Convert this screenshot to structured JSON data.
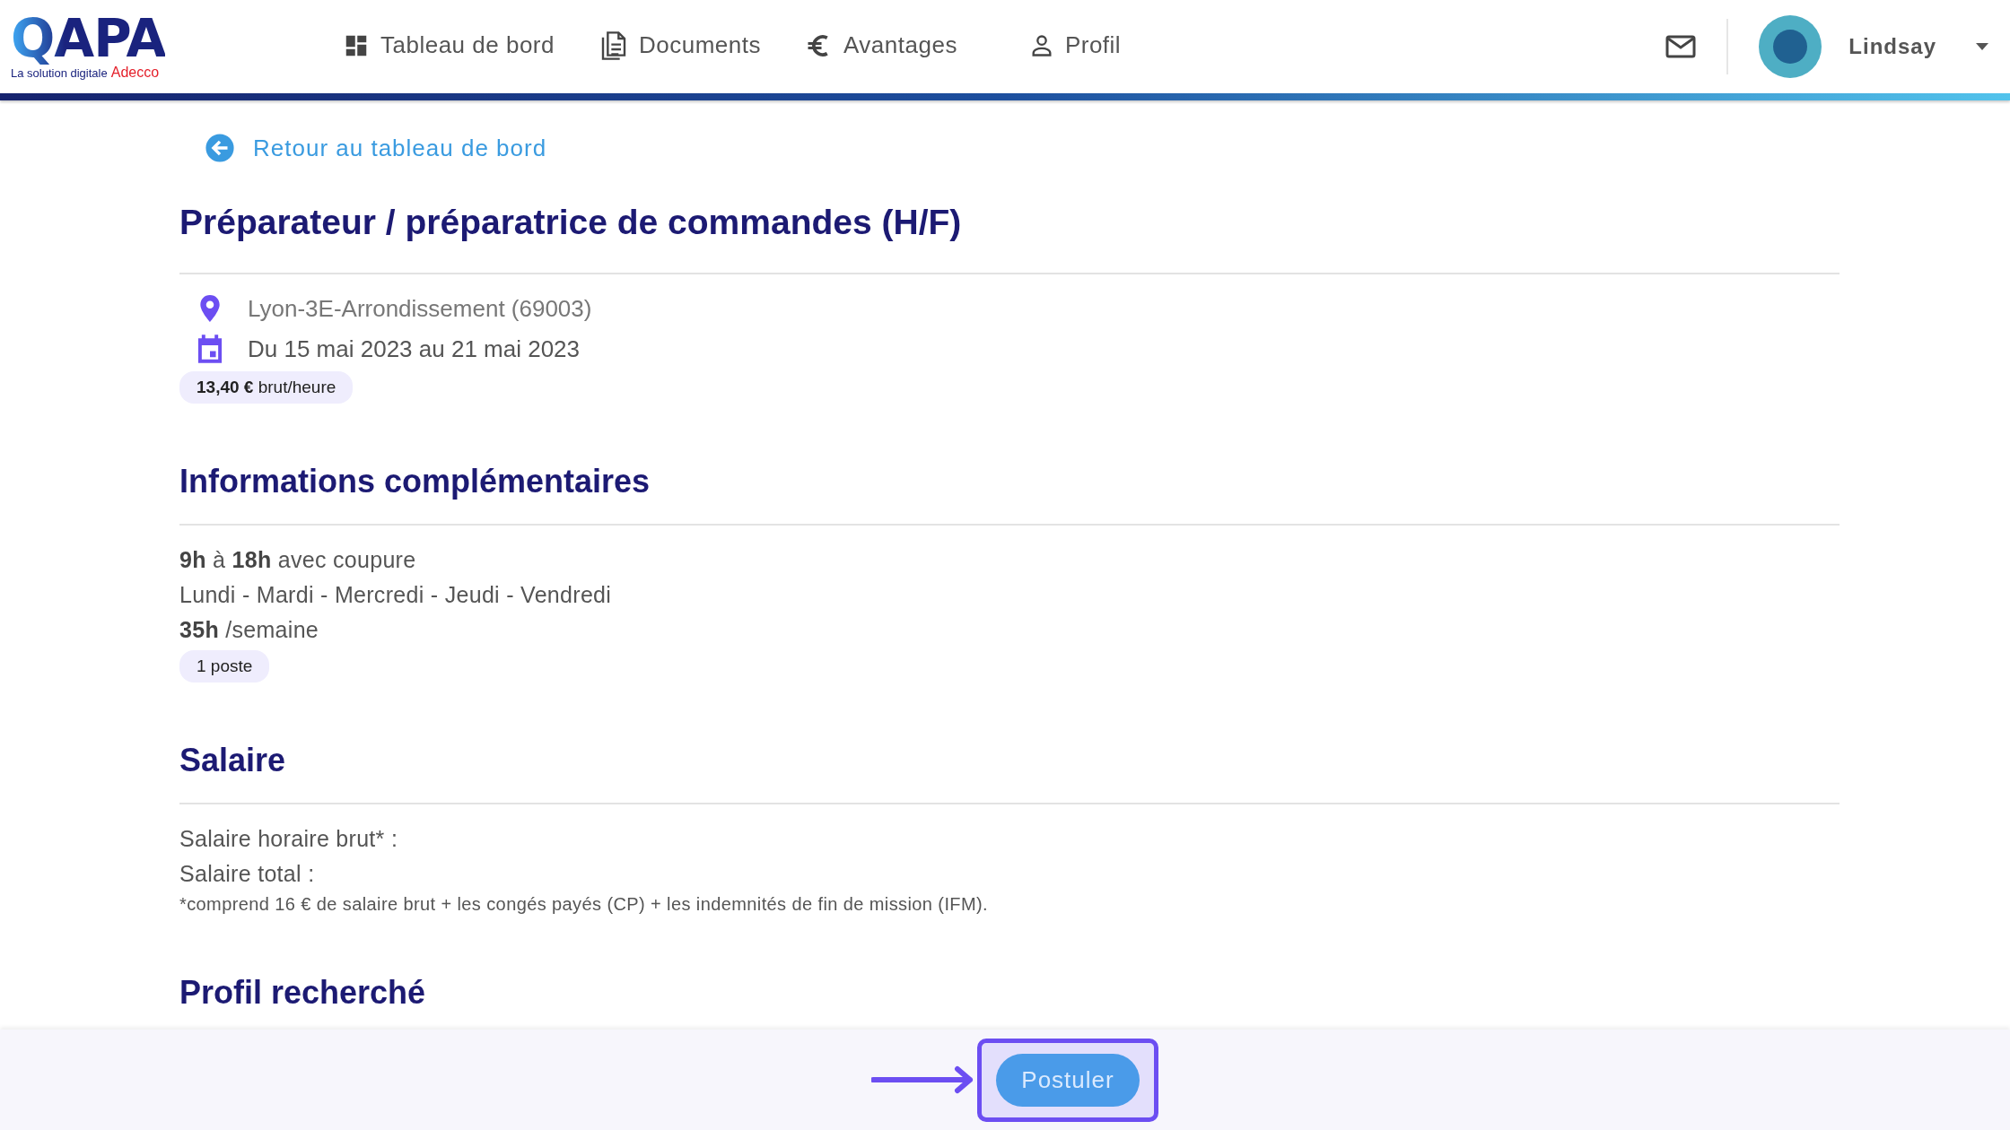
{
  "header": {
    "logo": {
      "wordmark": "QAPA",
      "tagline": "La solution digitale",
      "brand": "Adecco"
    },
    "nav": [
      {
        "label": "Tableau de bord",
        "kind": "dashboard",
        "selected": false
      },
      {
        "label": "Documents",
        "kind": "document",
        "selected": false
      },
      {
        "label": "Avantages",
        "kind": "euro",
        "selected": false
      },
      {
        "label": "Profil",
        "kind": "person",
        "selected": false
      }
    ],
    "user": {
      "name": "Lindsay"
    }
  },
  "back_link": "Retour au tableau de bord",
  "job": {
    "title": "Préparateur / préparatrice de commandes (H/F)",
    "details": [
      {
        "kind": "location",
        "text": "Lyon-3E-Arrondissement (69003)"
      },
      {
        "kind": "date",
        "text": "Du 15 mai 2023 au 21 mai 2023"
      }
    ],
    "rate": "**13,40 €** brut/heure"
  },
  "sections": [
    {
      "heading": "Informations complémentaires",
      "lines": [
        "**9h** à **18h** avec coupure",
        "Lundi - Mardi - Mercredi - Jeudi - Vendredi",
        "**35h** /semaine"
      ],
      "chip": "1 poste"
    },
    {
      "heading": "Salaire",
      "lines": [
        "Salaire horaire brut* :",
        "Salaire total :"
      ],
      "note": "*comprend 16 € de salaire brut + les congés payés (CP) + les indemnités de fin de mission (IFM)."
    },
    {
      "heading": "Profil recherché"
    }
  ],
  "footer": {
    "apply_button": "Postuler"
  }
}
